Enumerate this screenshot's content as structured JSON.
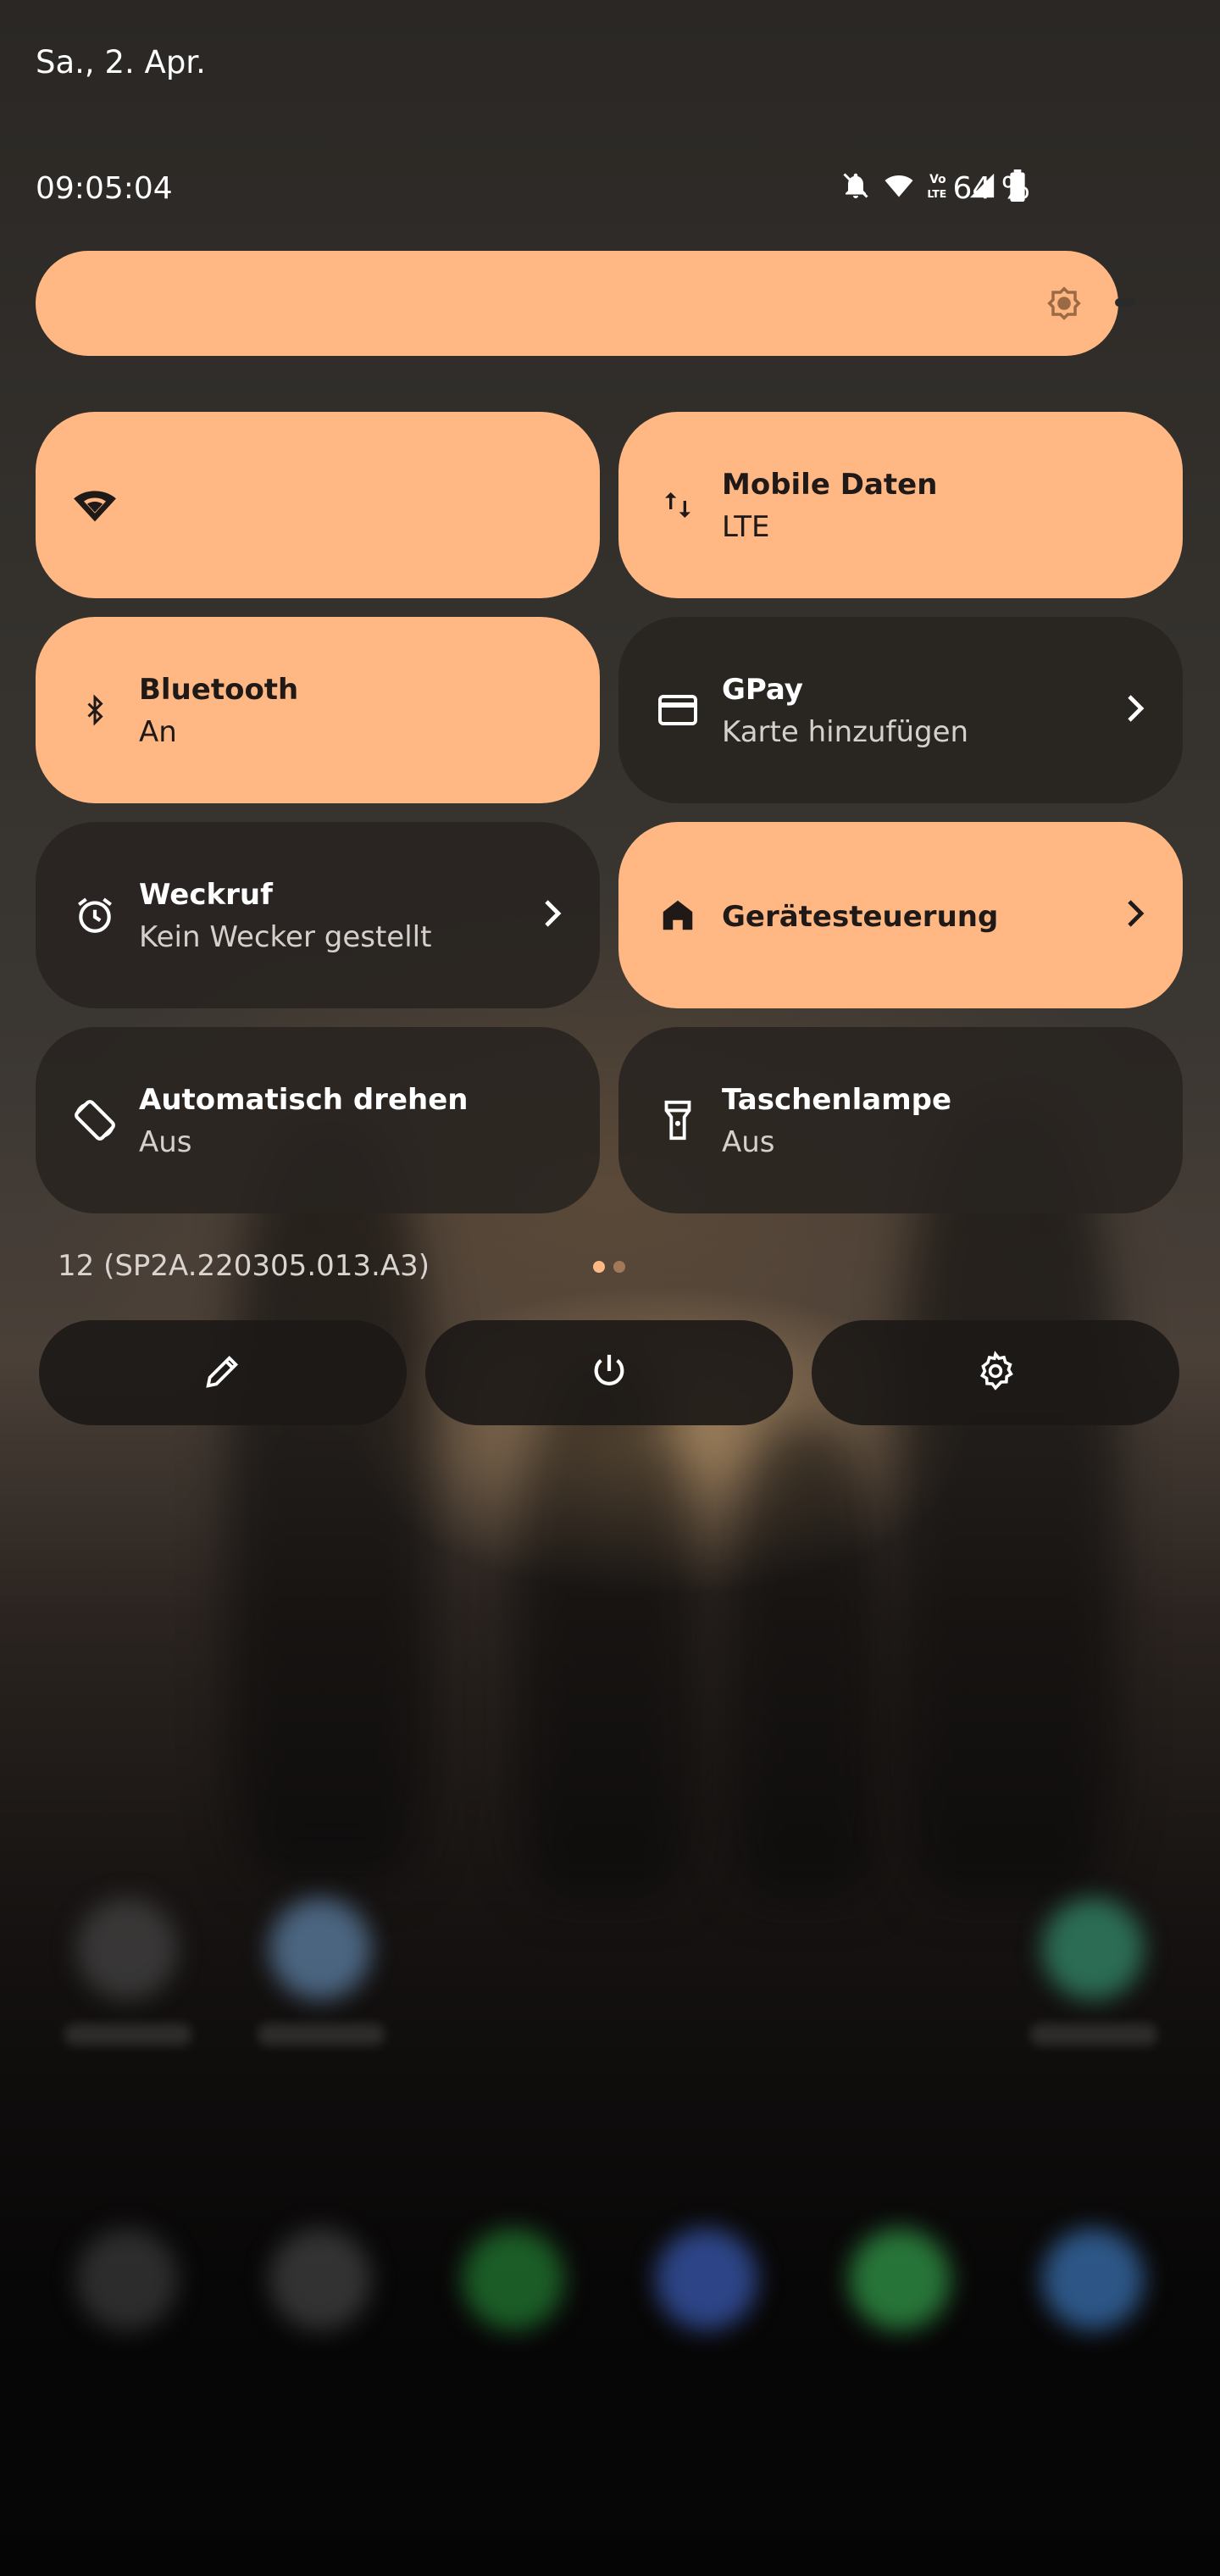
{
  "status_bar": {
    "date": "Sa., 2. Apr.",
    "time": "09:05:04",
    "battery_percent": "64 %",
    "icons": [
      "notifications-off-icon",
      "wifi-icon",
      "volte-icon",
      "signal-icon",
      "battery-icon"
    ]
  },
  "brightness": {
    "icon": "brightness-icon",
    "level": 0.97
  },
  "tiles": [
    {
      "id": "wifi",
      "title": "",
      "subtitle": "",
      "icon": "wifi-icon",
      "state": "on"
    },
    {
      "id": "mobile-data",
      "title": "Mobile Daten",
      "subtitle": "LTE",
      "icon": "mobile-data-icon",
      "state": "on"
    },
    {
      "id": "bluetooth",
      "title": "Bluetooth",
      "subtitle": "An",
      "icon": "bluetooth-icon",
      "state": "on"
    },
    {
      "id": "gpay",
      "title": "GPay",
      "subtitle": "Karte hinzufügen",
      "icon": "card-icon",
      "state": "off",
      "chevron": true
    },
    {
      "id": "alarm",
      "title": "Weckruf",
      "subtitle": "Kein Wecker gestellt",
      "icon": "alarm-icon",
      "state": "off",
      "chevron": true
    },
    {
      "id": "device-controls",
      "title": "Gerätesteuerung",
      "subtitle": "",
      "icon": "home-icon",
      "state": "on",
      "chevron": true
    },
    {
      "id": "auto-rotate",
      "title": "Automatisch drehen",
      "subtitle": "Aus",
      "icon": "rotate-icon",
      "state": "off"
    },
    {
      "id": "flashlight",
      "title": "Taschenlampe",
      "subtitle": "Aus",
      "icon": "flashlight-icon",
      "state": "off"
    }
  ],
  "build_number": "12 (SP2A.220305.013.A3)",
  "page_indicator": {
    "pages": 2,
    "current": 1
  },
  "actions": [
    {
      "id": "edit",
      "icon": "edit-icon"
    },
    {
      "id": "power",
      "icon": "power-icon"
    },
    {
      "id": "settings",
      "icon": "settings-icon"
    }
  ],
  "colors": {
    "tile_on": "#ffb884",
    "tile_off": "#2a2420",
    "text_on": "#1f1a17",
    "text_off": "#ffffff"
  }
}
